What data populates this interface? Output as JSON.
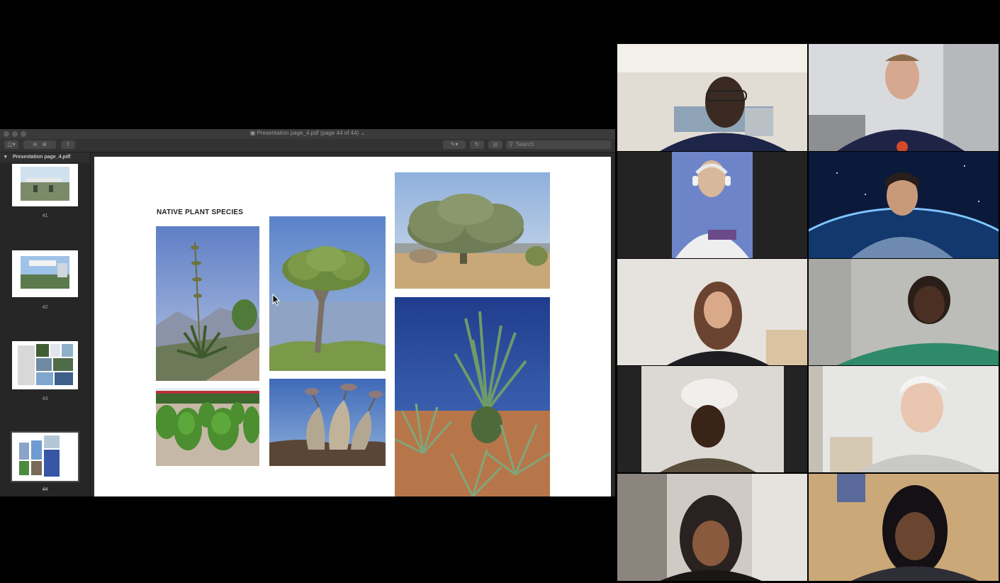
{
  "preview_window": {
    "title": "Presentation page_4.pdf (page 44 of 44)",
    "search_placeholder": "Search",
    "sidebar": {
      "document_name": "Presentation page_4.pdf",
      "thumbnails": [
        {
          "page": "41"
        },
        {
          "page": "42"
        },
        {
          "page": "43"
        },
        {
          "page": "44",
          "selected": true
        }
      ]
    },
    "slide": {
      "title": "NATIVE PLANT SPECIES",
      "photos": [
        "agave-flower-photo",
        "dragon-tree-photo",
        "candelabra-euphorbia-photo",
        "round-shrubs-photo",
        "bottle-tree-photo",
        "sansevieria-agave-photo"
      ]
    }
  },
  "video_grid": {
    "participants": 10,
    "background_color": "#232323"
  }
}
